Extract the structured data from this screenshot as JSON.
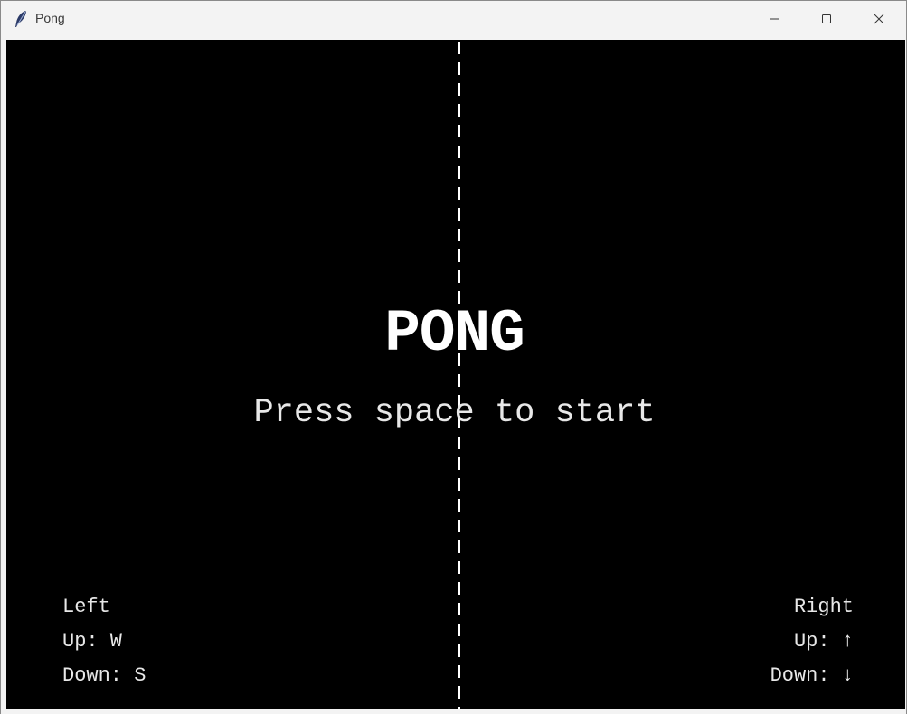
{
  "window": {
    "title": "Pong",
    "icon": "feather-icon",
    "controls": [
      "minimize-icon",
      "maximize-icon",
      "close-icon"
    ]
  },
  "game": {
    "title": "PONG",
    "prompt": "Press space to start",
    "background_color": "#000000",
    "foreground_color": "#ffffff",
    "left_controls": {
      "heading": "Left",
      "up": "Up: W",
      "down": "Down: S"
    },
    "right_controls": {
      "heading": "Right",
      "up": "Up: ↑",
      "down": "Down: ↓"
    }
  }
}
